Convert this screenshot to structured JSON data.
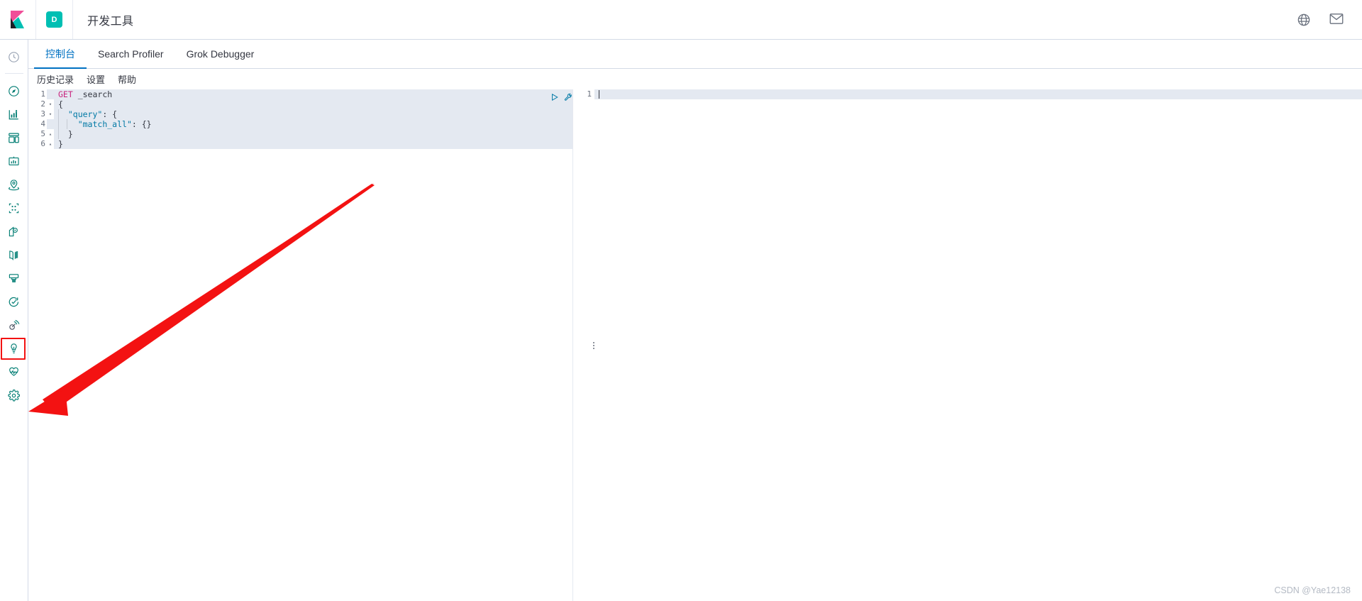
{
  "header": {
    "logo_icon": "kibana-logo-icon",
    "space_badge": "D",
    "space_badge_name": "space-avatar",
    "title": "开发工具",
    "help_icon": "help-circle-icon",
    "news_icon": "mail-icon"
  },
  "sidebar": {
    "items": [
      {
        "label": "最近访问",
        "icon": "clock-icon",
        "selected": false
      },
      {
        "label": "Discover",
        "icon": "compass-icon",
        "selected": false
      },
      {
        "label": "Visualize",
        "icon": "bar-chart-icon",
        "selected": false
      },
      {
        "label": "Dashboard",
        "icon": "dashboard-icon",
        "selected": false
      },
      {
        "label": "Canvas",
        "icon": "canvas-icon",
        "selected": false
      },
      {
        "label": "Maps",
        "icon": "map-marker-icon",
        "selected": false
      },
      {
        "label": "Machine Learning",
        "icon": "machine-learning-icon",
        "selected": false
      },
      {
        "label": "Infrastructure",
        "icon": "infrastructure-icon",
        "selected": false
      },
      {
        "label": "Logs",
        "icon": "logs-icon",
        "selected": false
      },
      {
        "label": "APM",
        "icon": "apm-icon",
        "selected": false
      },
      {
        "label": "Uptime",
        "icon": "uptime-icon",
        "selected": false
      },
      {
        "label": "SIEM",
        "icon": "siem-icon",
        "selected": false
      },
      {
        "label": "开发工具",
        "icon": "dev-tools-wrench-icon",
        "selected": true
      },
      {
        "label": "Monitoring",
        "icon": "monitoring-heart-icon",
        "selected": false
      },
      {
        "label": "Management",
        "icon": "gear-icon",
        "selected": false
      }
    ]
  },
  "tabs": [
    {
      "label": "控制台",
      "active": true
    },
    {
      "label": "Search Profiler",
      "active": false
    },
    {
      "label": "Grok Debugger",
      "active": false
    }
  ],
  "console_menu": [
    {
      "label": "历史记录"
    },
    {
      "label": "设置"
    },
    {
      "label": "帮助"
    }
  ],
  "editor": {
    "actions": [
      {
        "name": "send-request-play-icon",
        "title": "点击发送请求"
      },
      {
        "name": "wrench-icon",
        "title": "打开文档"
      }
    ],
    "lines": [
      {
        "num": "1",
        "fold": "",
        "segments": [
          {
            "text": "GET",
            "cls": "tok-method"
          },
          {
            "text": " _search",
            "cls": "tok-url"
          }
        ],
        "highlight": true
      },
      {
        "num": "2",
        "fold": "▾",
        "segments": [
          {
            "text": "{",
            "cls": "tok-punct"
          }
        ],
        "highlight": false
      },
      {
        "num": "3",
        "fold": "▾",
        "segments": [
          {
            "text": "  ",
            "cls": "tok-punct"
          },
          {
            "text": "\"query\"",
            "cls": "tok-key"
          },
          {
            "text": ": {",
            "cls": "tok-punct"
          }
        ],
        "highlight": false
      },
      {
        "num": "4",
        "fold": "",
        "segments": [
          {
            "text": "    ",
            "cls": "tok-punct"
          },
          {
            "text": "\"match_all\"",
            "cls": "tok-key"
          },
          {
            "text": ": {}",
            "cls": "tok-punct"
          }
        ],
        "highlight": false
      },
      {
        "num": "5",
        "fold": "▴",
        "segments": [
          {
            "text": "  }",
            "cls": "tok-punct"
          }
        ],
        "highlight": false
      },
      {
        "num": "6",
        "fold": "▴",
        "segments": [
          {
            "text": "}",
            "cls": "tok-punct"
          }
        ],
        "highlight": false
      }
    ]
  },
  "output": {
    "line_number": "1",
    "content": ""
  },
  "splitter": {
    "name": "pane-resize-handle"
  },
  "annotation": {
    "color": "#f31212",
    "target": "dev-tools-sidebar-icon"
  },
  "watermark": "CSDN @Yae12138",
  "colors": {
    "accent": "#0071c2",
    "brand_teal": "#00bfb3",
    "link": "#0079a5",
    "annotation_red": "#f31212",
    "code_key": "#0079a5",
    "code_method": "#c9257f"
  }
}
